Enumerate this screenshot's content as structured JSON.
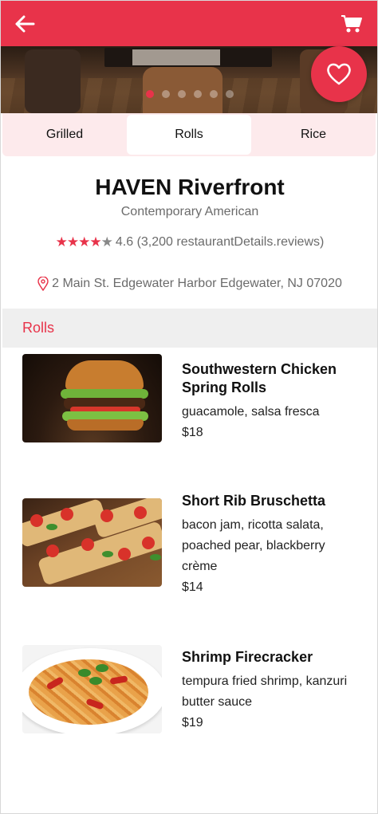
{
  "header": {
    "back_icon": "arrow-left-icon",
    "cart_icon": "shopping-cart-icon"
  },
  "hero": {
    "carousel_count": 6,
    "carousel_active_index": 0,
    "favorite_icon": "heart-icon"
  },
  "tabs": [
    {
      "label": "Grilled",
      "active": false
    },
    {
      "label": "Rolls",
      "active": true
    },
    {
      "label": "Rice",
      "active": false
    }
  ],
  "restaurant": {
    "name": "HAVEN Riverfront",
    "cuisine": "Contemporary American",
    "stars": "★★★★",
    "stars_empty": "★",
    "rating_text": "4.6 (3,200 restaurantDetails.reviews)",
    "address": "2 Main St. Edgewater Harbor Edgewater, NJ 07020",
    "location_icon": "map-pin-icon"
  },
  "section": {
    "title": "Rolls"
  },
  "menu": [
    {
      "name": "Southwestern Chicken Spring Rolls",
      "description": "guacamole, salsa fresca",
      "price": "$18",
      "image": "burger-photo"
    },
    {
      "name": "Short Rib Bruschetta",
      "description": "bacon jam, ricotta salata, poached pear, blackberry crème",
      "price": "$14",
      "image": "flatbread-pizza-photo"
    },
    {
      "name": "Shrimp Firecracker",
      "description": "tempura fried shrimp, kanzuri butter sauce",
      "price": "$19",
      "image": "pasta-photo"
    }
  ],
  "colors": {
    "accent": "#e8334a",
    "tab_bg": "#fdeaec",
    "section_bg": "#efefef",
    "muted_text": "#6b6b6b"
  }
}
